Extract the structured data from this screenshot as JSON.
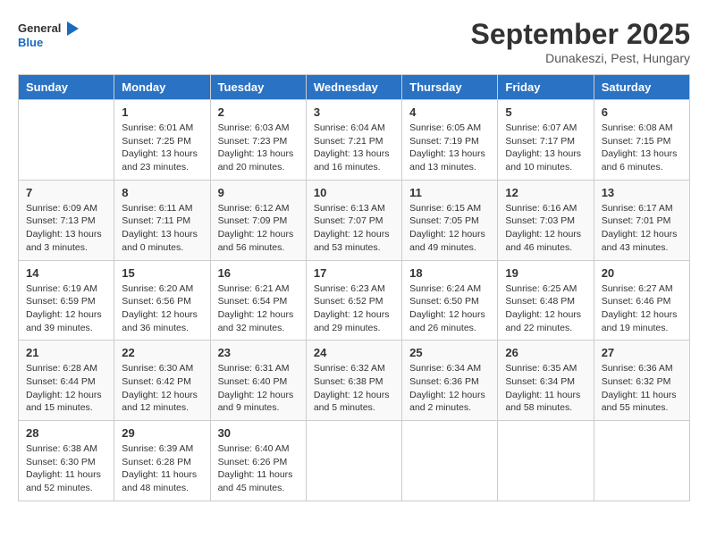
{
  "header": {
    "logo_general": "General",
    "logo_blue": "Blue",
    "month_year": "September 2025",
    "location": "Dunakeszi, Pest, Hungary"
  },
  "days_of_week": [
    "Sunday",
    "Monday",
    "Tuesday",
    "Wednesday",
    "Thursday",
    "Friday",
    "Saturday"
  ],
  "weeks": [
    [
      {
        "day": "",
        "info": ""
      },
      {
        "day": "1",
        "info": "Sunrise: 6:01 AM\nSunset: 7:25 PM\nDaylight: 13 hours\nand 23 minutes."
      },
      {
        "day": "2",
        "info": "Sunrise: 6:03 AM\nSunset: 7:23 PM\nDaylight: 13 hours\nand 20 minutes."
      },
      {
        "day": "3",
        "info": "Sunrise: 6:04 AM\nSunset: 7:21 PM\nDaylight: 13 hours\nand 16 minutes."
      },
      {
        "day": "4",
        "info": "Sunrise: 6:05 AM\nSunset: 7:19 PM\nDaylight: 13 hours\nand 13 minutes."
      },
      {
        "day": "5",
        "info": "Sunrise: 6:07 AM\nSunset: 7:17 PM\nDaylight: 13 hours\nand 10 minutes."
      },
      {
        "day": "6",
        "info": "Sunrise: 6:08 AM\nSunset: 7:15 PM\nDaylight: 13 hours\nand 6 minutes."
      }
    ],
    [
      {
        "day": "7",
        "info": "Sunrise: 6:09 AM\nSunset: 7:13 PM\nDaylight: 13 hours\nand 3 minutes."
      },
      {
        "day": "8",
        "info": "Sunrise: 6:11 AM\nSunset: 7:11 PM\nDaylight: 13 hours\nand 0 minutes."
      },
      {
        "day": "9",
        "info": "Sunrise: 6:12 AM\nSunset: 7:09 PM\nDaylight: 12 hours\nand 56 minutes."
      },
      {
        "day": "10",
        "info": "Sunrise: 6:13 AM\nSunset: 7:07 PM\nDaylight: 12 hours\nand 53 minutes."
      },
      {
        "day": "11",
        "info": "Sunrise: 6:15 AM\nSunset: 7:05 PM\nDaylight: 12 hours\nand 49 minutes."
      },
      {
        "day": "12",
        "info": "Sunrise: 6:16 AM\nSunset: 7:03 PM\nDaylight: 12 hours\nand 46 minutes."
      },
      {
        "day": "13",
        "info": "Sunrise: 6:17 AM\nSunset: 7:01 PM\nDaylight: 12 hours\nand 43 minutes."
      }
    ],
    [
      {
        "day": "14",
        "info": "Sunrise: 6:19 AM\nSunset: 6:59 PM\nDaylight: 12 hours\nand 39 minutes."
      },
      {
        "day": "15",
        "info": "Sunrise: 6:20 AM\nSunset: 6:56 PM\nDaylight: 12 hours\nand 36 minutes."
      },
      {
        "day": "16",
        "info": "Sunrise: 6:21 AM\nSunset: 6:54 PM\nDaylight: 12 hours\nand 32 minutes."
      },
      {
        "day": "17",
        "info": "Sunrise: 6:23 AM\nSunset: 6:52 PM\nDaylight: 12 hours\nand 29 minutes."
      },
      {
        "day": "18",
        "info": "Sunrise: 6:24 AM\nSunset: 6:50 PM\nDaylight: 12 hours\nand 26 minutes."
      },
      {
        "day": "19",
        "info": "Sunrise: 6:25 AM\nSunset: 6:48 PM\nDaylight: 12 hours\nand 22 minutes."
      },
      {
        "day": "20",
        "info": "Sunrise: 6:27 AM\nSunset: 6:46 PM\nDaylight: 12 hours\nand 19 minutes."
      }
    ],
    [
      {
        "day": "21",
        "info": "Sunrise: 6:28 AM\nSunset: 6:44 PM\nDaylight: 12 hours\nand 15 minutes."
      },
      {
        "day": "22",
        "info": "Sunrise: 6:30 AM\nSunset: 6:42 PM\nDaylight: 12 hours\nand 12 minutes."
      },
      {
        "day": "23",
        "info": "Sunrise: 6:31 AM\nSunset: 6:40 PM\nDaylight: 12 hours\nand 9 minutes."
      },
      {
        "day": "24",
        "info": "Sunrise: 6:32 AM\nSunset: 6:38 PM\nDaylight: 12 hours\nand 5 minutes."
      },
      {
        "day": "25",
        "info": "Sunrise: 6:34 AM\nSunset: 6:36 PM\nDaylight: 12 hours\nand 2 minutes."
      },
      {
        "day": "26",
        "info": "Sunrise: 6:35 AM\nSunset: 6:34 PM\nDaylight: 11 hours\nand 58 minutes."
      },
      {
        "day": "27",
        "info": "Sunrise: 6:36 AM\nSunset: 6:32 PM\nDaylight: 11 hours\nand 55 minutes."
      }
    ],
    [
      {
        "day": "28",
        "info": "Sunrise: 6:38 AM\nSunset: 6:30 PM\nDaylight: 11 hours\nand 52 minutes."
      },
      {
        "day": "29",
        "info": "Sunrise: 6:39 AM\nSunset: 6:28 PM\nDaylight: 11 hours\nand 48 minutes."
      },
      {
        "day": "30",
        "info": "Sunrise: 6:40 AM\nSunset: 6:26 PM\nDaylight: 11 hours\nand 45 minutes."
      },
      {
        "day": "",
        "info": ""
      },
      {
        "day": "",
        "info": ""
      },
      {
        "day": "",
        "info": ""
      },
      {
        "day": "",
        "info": ""
      }
    ]
  ]
}
